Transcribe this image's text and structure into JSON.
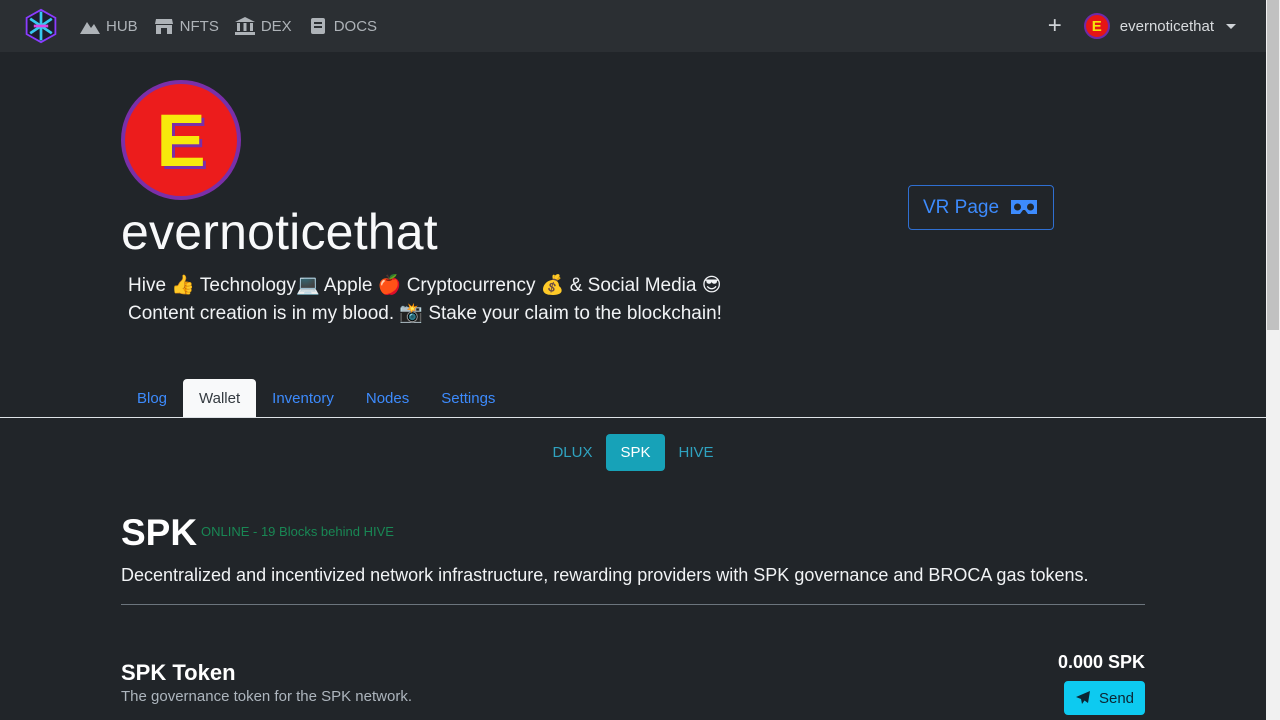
{
  "nav": {
    "links": [
      {
        "label": "HUB",
        "icon": "mountain-icon"
      },
      {
        "label": "NFTS",
        "icon": "store-icon"
      },
      {
        "label": "DEX",
        "icon": "bank-icon"
      },
      {
        "label": "DOCS",
        "icon": "book-icon"
      }
    ],
    "add": "+",
    "avatar_letter": "E",
    "username": "evernoticethat"
  },
  "profile": {
    "avatar_letter": "E",
    "name": "evernoticethat",
    "bio": "Hive 👍 Technology💻 Apple 🍎 Cryptocurrency 💰 & Social Media 😎 Content creation is in my blood. 📸 Stake your claim to the blockchain!",
    "vr_label": "VR Page"
  },
  "tabs": [
    "Blog",
    "Wallet",
    "Inventory",
    "Nodes",
    "Settings"
  ],
  "active_tab": "Wallet",
  "pills": [
    "DLUX",
    "SPK",
    "HIVE"
  ],
  "active_pill": "SPK",
  "section": {
    "title": "SPK",
    "status": "ONLINE - 19 Blocks behind HIVE",
    "description": "Decentralized and incentivized network infrastructure, rewarding providers with SPK governance and BROCA gas tokens."
  },
  "token": {
    "title": "SPK Token",
    "subtitle": "The governance token for the SPK network.",
    "balance": "0.000 SPK",
    "send_label": "Send"
  },
  "colors": {
    "background": "#212529",
    "navbar": "#2b2f33",
    "link": "#3d8bfd",
    "info": "#17a2b8",
    "success": "#198754"
  }
}
